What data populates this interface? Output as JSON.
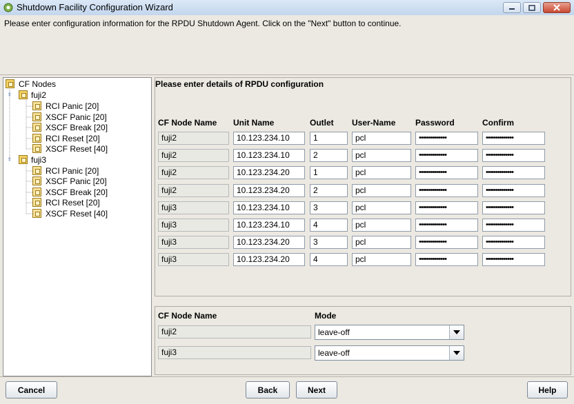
{
  "window": {
    "title": "Shutdown Facility Configuration Wizard",
    "icons": [
      "minimize-icon",
      "maximize-icon",
      "close-icon"
    ]
  },
  "instruction": "Please enter configuration information for the RPDU Shutdown Agent. Click on the \"Next\" button to continue.",
  "tree": {
    "root": "CF Nodes",
    "nodes": [
      {
        "label": "fuji2",
        "children": [
          "RCI Panic [20]",
          "XSCF Panic [20]",
          "XSCF Break [20]",
          "RCI Reset [20]",
          "XSCF Reset [40]"
        ]
      },
      {
        "label": "fuji3",
        "children": [
          "RCI Panic [20]",
          "XSCF Panic [20]",
          "XSCF Break [20]",
          "RCI Reset [20]",
          "XSCF Reset [40]"
        ]
      }
    ]
  },
  "rpdu": {
    "heading": "Please enter details of RPDU configuration",
    "columns": [
      "CF Node Name",
      "Unit Name",
      "Outlet",
      "User-Name",
      "Password",
      "Confirm"
    ],
    "rows": [
      {
        "node": "fuji2",
        "unit": "10.123.234.10",
        "outlet": "1",
        "user": "pcl",
        "password": "••••••••••••••",
        "confirm": "••••••••••••••"
      },
      {
        "node": "fuji2",
        "unit": "10.123.234.10",
        "outlet": "2",
        "user": "pcl",
        "password": "••••••••••••••",
        "confirm": "••••••••••••••"
      },
      {
        "node": "fuji2",
        "unit": "10.123.234.20",
        "outlet": "1",
        "user": "pcl",
        "password": "••••••••••••••",
        "confirm": "••••••••••••••"
      },
      {
        "node": "fuji2",
        "unit": "10.123.234.20",
        "outlet": "2",
        "user": "pcl",
        "password": "••••••••••••••",
        "confirm": "••••••••••••••"
      },
      {
        "node": "fuji3",
        "unit": "10.123.234.10",
        "outlet": "3",
        "user": "pcl",
        "password": "••••••••••••••",
        "confirm": "••••••••••••••"
      },
      {
        "node": "fuji3",
        "unit": "10.123.234.10",
        "outlet": "4",
        "user": "pcl",
        "password": "••••••••••••••",
        "confirm": "••••••••••••••"
      },
      {
        "node": "fuji3",
        "unit": "10.123.234.20",
        "outlet": "3",
        "user": "pcl",
        "password": "••••••••••••••",
        "confirm": "••••••••••••••"
      },
      {
        "node": "fuji3",
        "unit": "10.123.234.20",
        "outlet": "4",
        "user": "pcl",
        "password": "••••••••••••••",
        "confirm": "••••••••••••••"
      }
    ]
  },
  "mode": {
    "columns": [
      "CF Node Name",
      "Mode"
    ],
    "rows": [
      {
        "node": "fuji2",
        "mode": "leave-off"
      },
      {
        "node": "fuji3",
        "mode": "leave-off"
      }
    ]
  },
  "buttons": {
    "cancel": "Cancel",
    "back": "Back",
    "next": "Next",
    "help": "Help"
  }
}
